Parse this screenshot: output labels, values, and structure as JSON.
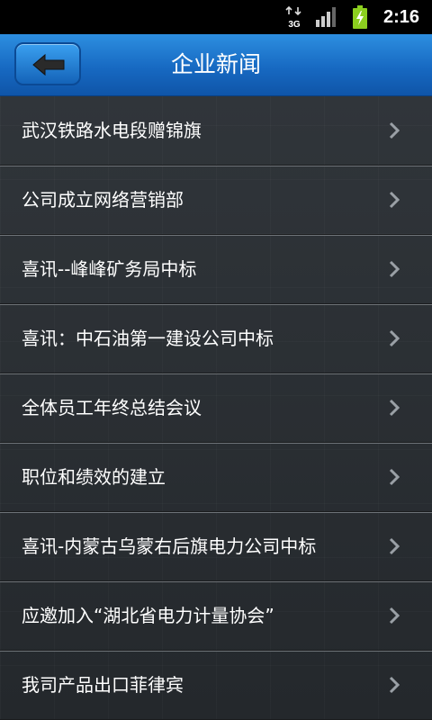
{
  "status_bar": {
    "network_type": "3G",
    "time": "2:16"
  },
  "header": {
    "title": "企业新闻",
    "back_icon": "back-arrow-icon"
  },
  "news": [
    {
      "title": "武汉铁路水电段赠锦旗"
    },
    {
      "title": "公司成立网络营销部"
    },
    {
      "title": "喜讯--峰峰矿务局中标"
    },
    {
      "title": "喜讯：中石油第一建设公司中标"
    },
    {
      "title": "全体员工年终总结会议"
    },
    {
      "title": "职位和绩效的建立"
    },
    {
      "title": "喜讯-内蒙古乌蒙右后旗电力公司中标"
    },
    {
      "title": "应邀加入“湖北省电力计量协会”"
    },
    {
      "title": "我司产品出口菲律宾"
    }
  ],
  "colors": {
    "header_blue": "#1769c2",
    "battery_green": "#8ccf1f"
  }
}
